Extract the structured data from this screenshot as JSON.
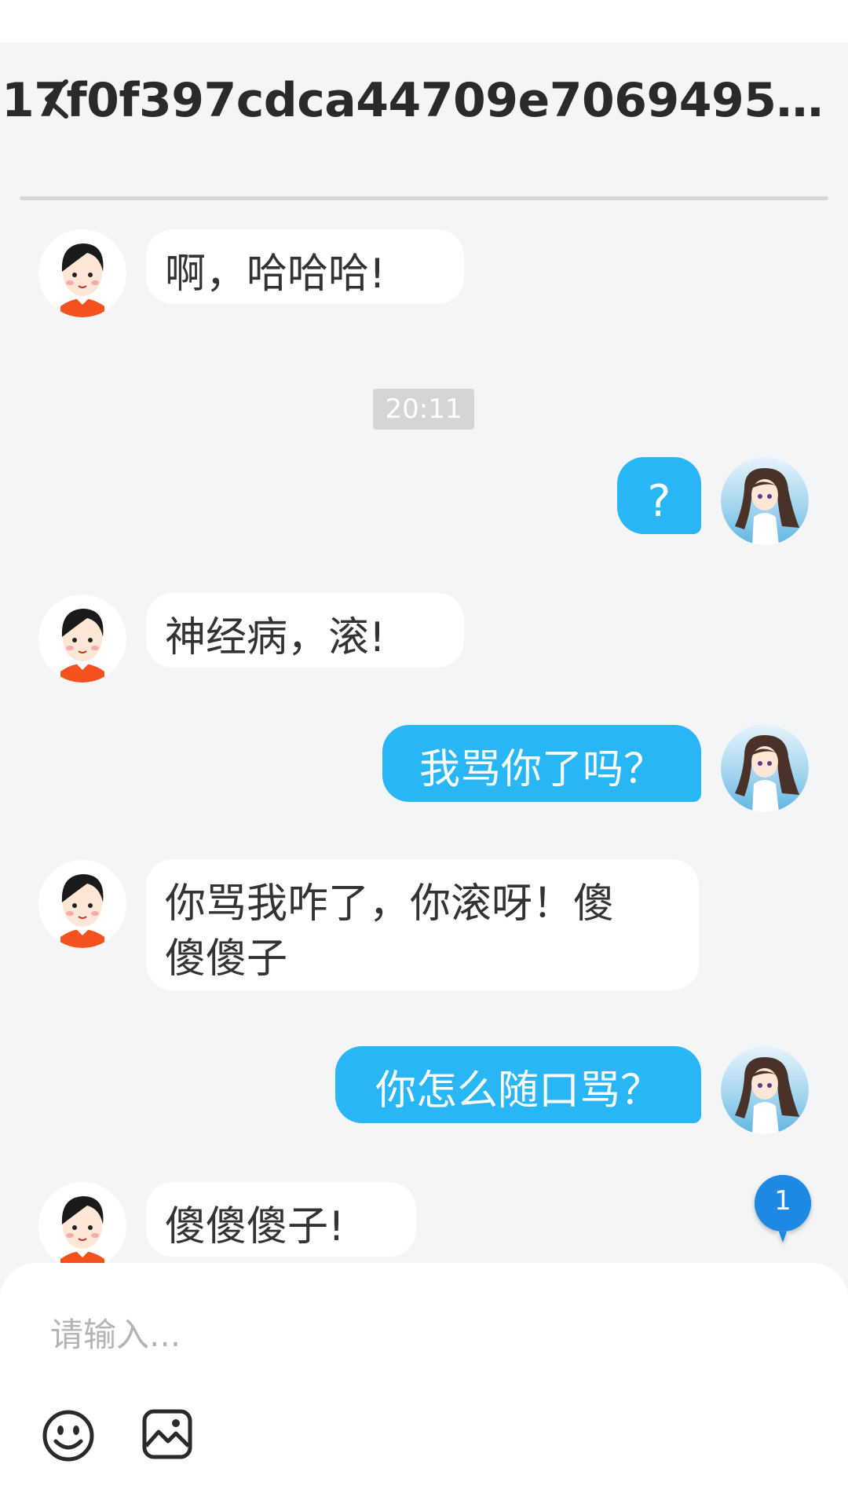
{
  "header": {
    "title": "17f0f397cdca44709e7069495dcfc5..."
  },
  "messages": [
    {
      "side": "recv",
      "text": "啊，哈哈哈!"
    },
    {
      "side": "time",
      "text": "20:11"
    },
    {
      "side": "sent",
      "text": "?"
    },
    {
      "side": "recv",
      "text": "神经病，滚!"
    },
    {
      "side": "sent",
      "text": "我骂你了吗？"
    },
    {
      "side": "recv",
      "text": "你骂我咋了，你滚呀！傻\n傻傻子"
    },
    {
      "side": "sent",
      "text": "你怎么随口骂？"
    },
    {
      "side": "recv",
      "text": "傻傻傻子!"
    }
  ],
  "unread": {
    "count": "1"
  },
  "composer": {
    "placeholder": "请输入..."
  },
  "icons": {
    "back": "back-arrow-icon",
    "emoji": "smiley-icon",
    "image": "image-icon"
  },
  "colors": {
    "sent_bubble": "#29b6f6",
    "unread_badge": "#1e88e5",
    "background": "#f4f5f7"
  }
}
